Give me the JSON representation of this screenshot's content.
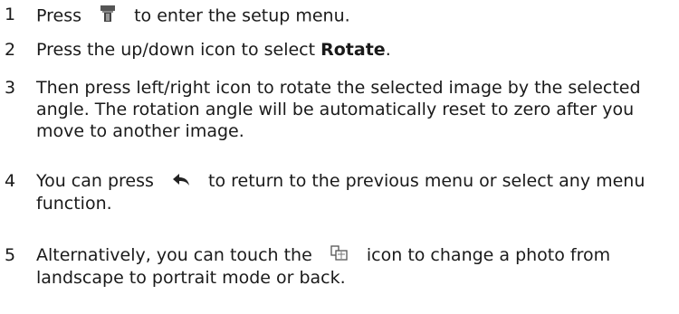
{
  "steps": [
    {
      "number": "1",
      "before": "Press",
      "icon": "setup-camera-icon",
      "after": "to enter the setup menu."
    },
    {
      "number": "2",
      "before": "Press the up/down icon to select ",
      "bold": "Rotate",
      "after": "."
    },
    {
      "number": "3",
      "lines": [
        "Then press left/right icon to rotate the selected image by the selected",
        "angle. The rotation angle will be automatically reset to zero after you",
        "move to another image."
      ]
    },
    {
      "number": "4",
      "before": "You can press",
      "icon": "return-arrow-icon",
      "after": "to return to the previous menu or select any menu",
      "line2": "function."
    },
    {
      "number": "5",
      "before": "Alternatively, you can touch the",
      "icon": "rotate-photo-icon",
      "after": "icon to change a photo from",
      "line2": "landscape to portrait mode or back."
    }
  ]
}
